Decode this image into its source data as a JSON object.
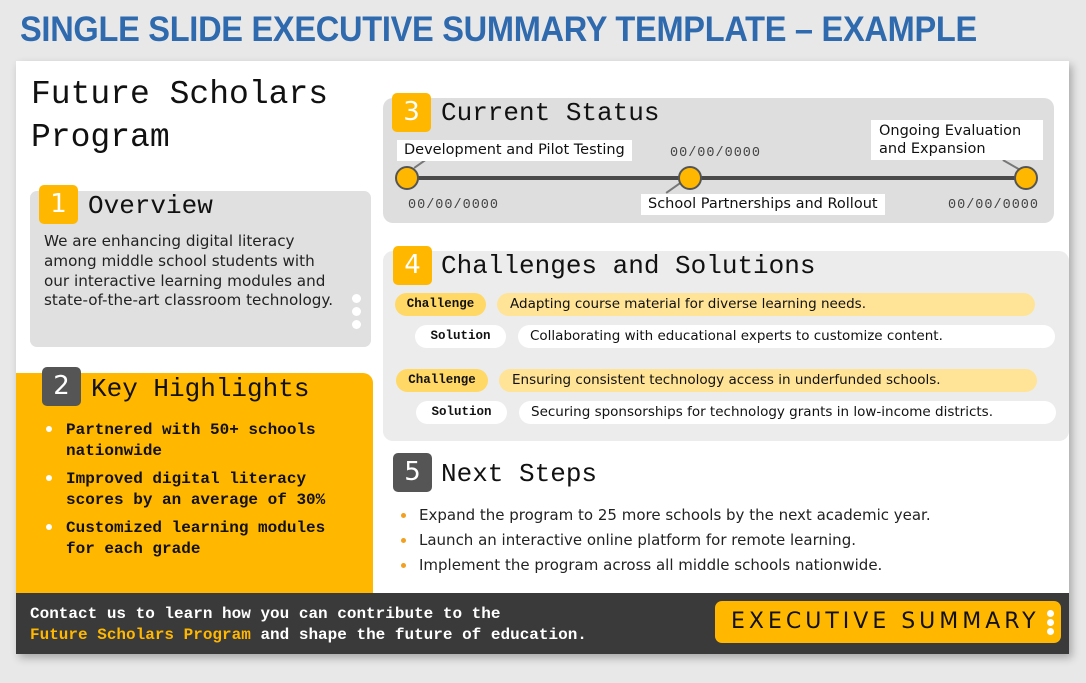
{
  "page_title": "SINGLE SLIDE EXECUTIVE SUMMARY TEMPLATE – EXAMPLE",
  "colors": {
    "title_blue": "#2e6aad",
    "accent_yellow": "#ffb700",
    "dark_gray": "#3a3a3a",
    "badge_dark": "#555555",
    "challenge_fill": "#ffe396"
  },
  "slide": {
    "program_title_line1": "Future Scholars",
    "program_title_line2": "Program",
    "overview": {
      "number": "1",
      "title": "Overview",
      "text": "We are enhancing digital literacy among middle school students with our interactive learning modules and state-of-the-art classroom technology.",
      "icon": "vertical-dots-icon"
    },
    "highlights": {
      "number": "2",
      "title": "Key Highlights",
      "items": [
        "Partnered with 50+ schools nationwide",
        "Improved digital literacy scores by an average of 30%",
        "Customized learning modules for each grade"
      ]
    },
    "status": {
      "number": "3",
      "title": "Current Status",
      "milestones": [
        {
          "label": "Development and Pilot Testing",
          "date": "00/00/0000"
        },
        {
          "label": "School Partnerships and Rollout",
          "date": "00/00/0000"
        },
        {
          "label": "Ongoing Evaluation and Expansion",
          "date": "00/00/0000"
        }
      ]
    },
    "challenges": {
      "number": "4",
      "title": "Challenges and Solutions",
      "challenge_tag": "Challenge",
      "solution_tag": "Solution",
      "pairs": [
        {
          "challenge": "Adapting course material for diverse learning needs.",
          "solution": "Collaborating with educational experts to customize content."
        },
        {
          "challenge": "Ensuring consistent technology access in underfunded schools.",
          "solution": "Securing sponsorships for technology grants in low-income districts."
        }
      ]
    },
    "next_steps": {
      "number": "5",
      "title": "Next Steps",
      "items": [
        "Expand the program to 25 more schools by the next academic year.",
        "Launch an interactive online platform for remote learning.",
        "Implement the program across all middle schools nationwide."
      ]
    },
    "footer": {
      "line1": "Contact us to learn how you can contribute to the",
      "accent": "Future Scholars Program",
      "line2_rest": " and shape the future of education.",
      "badge_label": "EXECUTIVE SUMMARY",
      "badge_icon": "vertical-dots-icon"
    }
  }
}
